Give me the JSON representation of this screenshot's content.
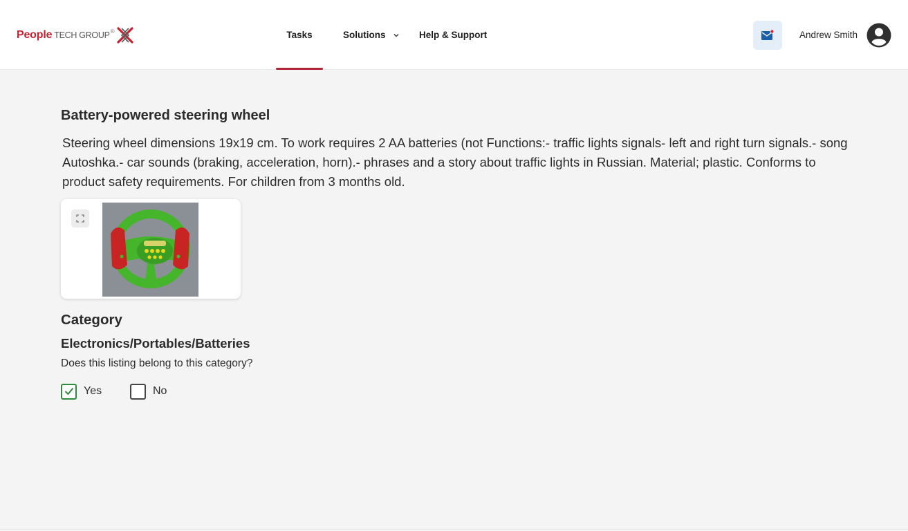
{
  "header": {
    "logo": {
      "people": "People",
      "rest": "TECH GROUP",
      "reg": "®"
    },
    "nav": [
      {
        "label": "Tasks",
        "active": true
      },
      {
        "label": "Solutions",
        "has_dropdown": true
      },
      {
        "label": "Help & Support"
      }
    ],
    "mail_icon": "mail-icon",
    "user_name": "Andrew Smith",
    "avatar_icon": "account-circle-icon",
    "accent_color": "#b0263a"
  },
  "listing": {
    "title": "Battery-powered steering wheel",
    "description": "Steering wheel dimensions 19x19 cm. To work requires 2 AA batteries (not Functions:- traffic lights signals- left and right turn signals.- song Autoshka.- car sounds (braking, acceleration, horn).- phrases and a story about traffic lights in Russian. Material; plastic. Conforms to product safety requirements. For children from 3 months old.",
    "expand_icon": "expand-icon"
  },
  "category": {
    "heading": "Category",
    "path": "Electronics/Portables/Batteries",
    "question": "Does this listing belong to this category?",
    "options": [
      {
        "label": "Yes",
        "checked": true
      },
      {
        "label": "No",
        "checked": false
      }
    ],
    "check_color": "#2e8b3d"
  }
}
